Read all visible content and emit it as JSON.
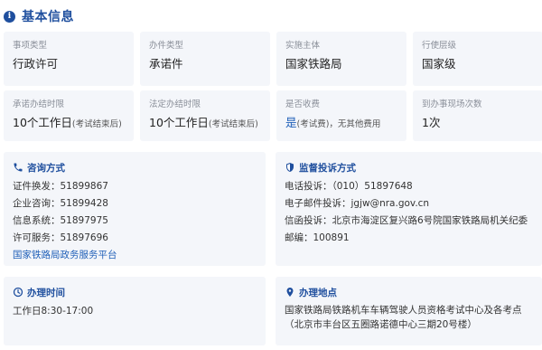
{
  "section": {
    "title": "基本信息",
    "icon": "info-icon"
  },
  "cards_row1": [
    {
      "label": "事项类型",
      "value": "行政许可"
    },
    {
      "label": "办件类型",
      "value": "承诺件"
    },
    {
      "label": "实施主体",
      "value": "国家铁路局"
    },
    {
      "label": "行使层级",
      "value": "国家级"
    }
  ],
  "cards_row2": [
    {
      "label": "承诺办结时限",
      "value": "10个工作日",
      "note": "(考试结束后)"
    },
    {
      "label": "法定办结时限",
      "value": "10个工作日",
      "note": "(考试结束后)"
    },
    {
      "label": "是否收费",
      "value": "是",
      "note": "(考试费)，无其他费用"
    },
    {
      "label": "到办事现场次数",
      "value": "1次"
    }
  ],
  "consult": {
    "title": "咨询方式",
    "icon": "phone-icon",
    "lines": [
      "证件换发：51899867",
      "企业咨询：51899428",
      "信息系统：51897975",
      "许可服务：51897696"
    ],
    "link": "国家铁路局政务服务平台"
  },
  "supervise": {
    "title": "监督投诉方式",
    "icon": "shield-icon",
    "phone": "电话投诉：（010）51897648",
    "email": "电子邮件投诉：jgjw@nra.gov.cn",
    "letter": "信函投诉：北京市海淀区复兴路6号院国家铁路局机关纪委",
    "postcode": "邮编：100891"
  },
  "hours": {
    "title": "办理时间",
    "icon": "clock-icon",
    "value": "工作日8:30-17:00"
  },
  "place": {
    "title": "办理地点",
    "icon": "location-pin-icon",
    "line1": "国家铁路局铁路机车车辆驾驶人员资格考试中心及各考点",
    "line2": "（北京市丰台区五圈路诺德中心三期20号楼）"
  },
  "colors": {
    "accent": "#1f4f9e",
    "link": "#1f5fb8",
    "card_bg": "#f4f6fa",
    "label": "#8a8f99"
  }
}
